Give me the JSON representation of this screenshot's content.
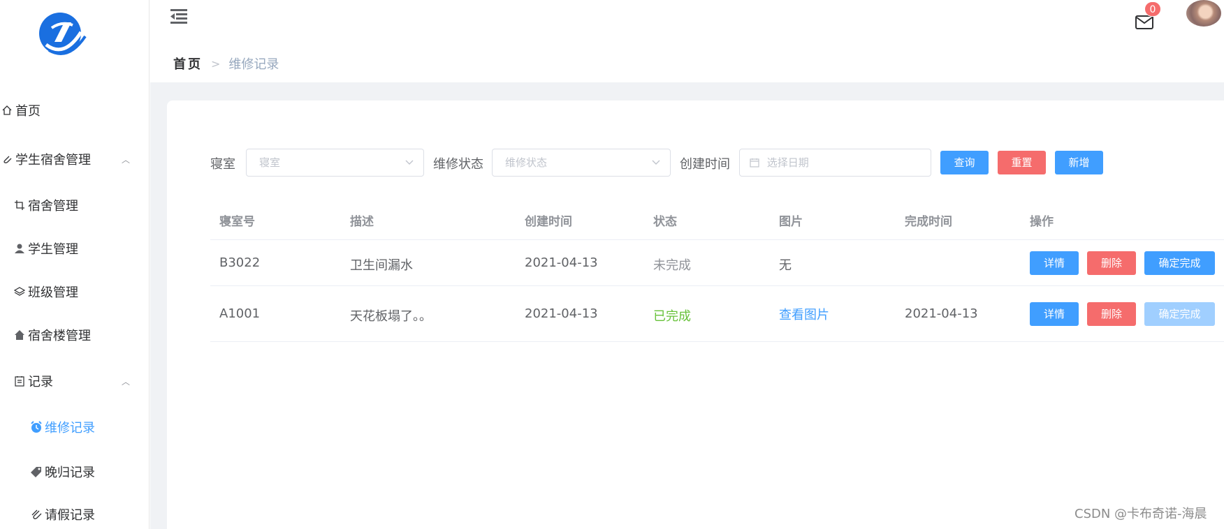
{
  "sidebar": {
    "items": [
      {
        "label": "首页",
        "icon": "home-icon"
      },
      {
        "label": "学生宿舍管理",
        "icon": "paperclip-icon",
        "expanded": true
      },
      {
        "label": "宿舍管理",
        "icon": "crop-icon"
      },
      {
        "label": "学生管理",
        "icon": "user-icon"
      },
      {
        "label": "班级管理",
        "icon": "layers-icon"
      },
      {
        "label": "宿舍楼管理",
        "icon": "house-icon"
      },
      {
        "label": "记录",
        "icon": "document-icon",
        "expanded": true
      },
      {
        "label": "维修记录",
        "icon": "alarm-clock-icon",
        "active": true
      },
      {
        "label": "晚归记录",
        "icon": "tag-icon"
      },
      {
        "label": "请假记录",
        "icon": "paperclip-icon"
      }
    ]
  },
  "header": {
    "breadcrumb_home": "首页",
    "breadcrumb_current": "维修记录",
    "mail_badge": "0"
  },
  "filters": {
    "dorm_label": "寝室",
    "dorm_placeholder": "寝室",
    "status_label": "维修状态",
    "status_placeholder": "维修状态",
    "created_label": "创建时间",
    "created_placeholder": "选择日期",
    "query_btn": "查询",
    "reset_btn": "重置",
    "add_btn": "新增"
  },
  "table": {
    "headers": [
      "寝室号",
      "描述",
      "创建时间",
      "状态",
      "图片",
      "完成时间",
      "操作"
    ],
    "rows": [
      {
        "room": "B3022",
        "desc": "卫生间漏水",
        "created": "2021-04-13",
        "status": "未完成",
        "image": "无",
        "finished": "",
        "btn_detail": "详情",
        "btn_delete": "删除",
        "btn_confirm": "确定完成"
      },
      {
        "room": "A1001",
        "desc": "天花板塌了。。",
        "created": "2021-04-13",
        "status": "已完成",
        "image": "查看图片",
        "finished": "2021-04-13",
        "btn_detail": "详情",
        "btn_delete": "删除",
        "btn_confirm": "确定完成"
      }
    ]
  },
  "colors": {
    "primary": "#409eff",
    "danger": "#f56c6c",
    "success": "#67c23a",
    "pending": "#909399"
  },
  "watermark": "CSDN @卡布奇诺-海晨"
}
